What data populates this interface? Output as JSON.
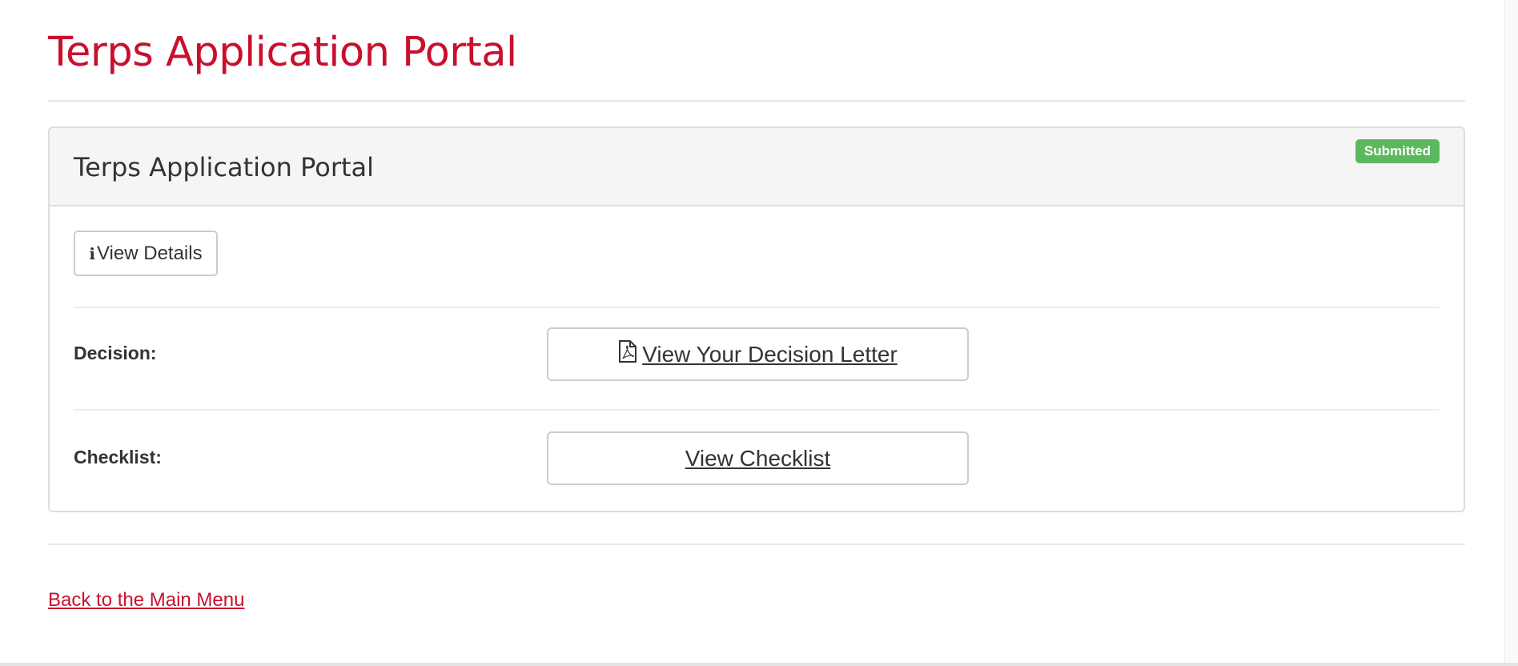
{
  "page": {
    "title": "Terps Application Portal"
  },
  "panel": {
    "title": "Terps Application Portal",
    "status_badge": "Submitted",
    "view_details_label": "View Details",
    "rows": [
      {
        "label": "Decision:",
        "button_label": "View Your Decision Letter",
        "icon": "file-pdf-icon"
      },
      {
        "label": "Checklist:",
        "button_label": "View Checklist"
      }
    ]
  },
  "footer": {
    "back_link": "Back to the Main Menu"
  },
  "colors": {
    "brand_red": "#c8102e",
    "badge_green": "#5cb85c"
  }
}
